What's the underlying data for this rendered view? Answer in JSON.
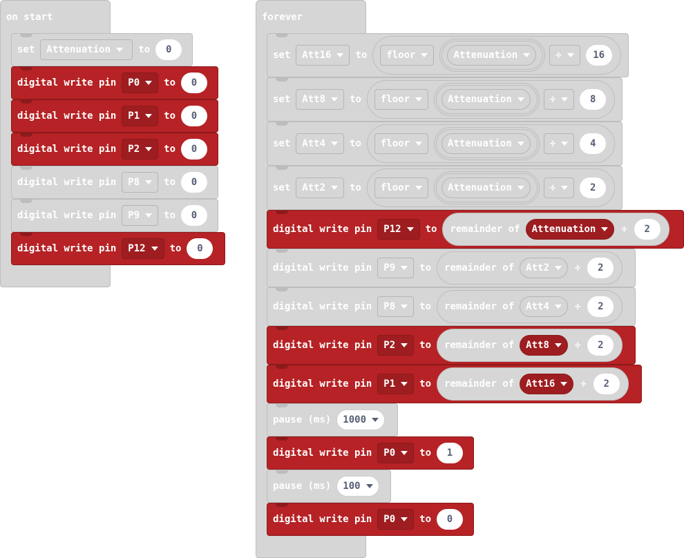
{
  "on_start": {
    "title": "on start",
    "set_block": {
      "set_label": "set",
      "variable": "Attenuation",
      "to_label": "to",
      "value": "0"
    },
    "writes": [
      {
        "label": "digital write pin",
        "pin": "P0",
        "to_label": "to",
        "value": "0",
        "enabled": true
      },
      {
        "label": "digital write pin",
        "pin": "P1",
        "to_label": "to",
        "value": "0",
        "enabled": true
      },
      {
        "label": "digital write pin",
        "pin": "P2",
        "to_label": "to",
        "value": "0",
        "enabled": true
      },
      {
        "label": "digital write pin",
        "pin": "P8",
        "to_label": "to",
        "value": "0",
        "enabled": false
      },
      {
        "label": "digital write pin",
        "pin": "P9",
        "to_label": "to",
        "value": "0",
        "enabled": false
      },
      {
        "label": "digital write pin",
        "pin": "P12",
        "to_label": "to",
        "value": "0",
        "enabled": true
      }
    ]
  },
  "forever": {
    "title": "forever",
    "set_blocks": [
      {
        "set_label": "set",
        "variable": "Att16",
        "to_label": "to",
        "func": "floor",
        "operand": "Attenuation",
        "op": "÷",
        "divisor": "16"
      },
      {
        "set_label": "set",
        "variable": "Att8",
        "to_label": "to",
        "func": "floor",
        "operand": "Attenuation",
        "op": "÷",
        "divisor": "8"
      },
      {
        "set_label": "set",
        "variable": "Att4",
        "to_label": "to",
        "func": "floor",
        "operand": "Attenuation",
        "op": "÷",
        "divisor": "4"
      },
      {
        "set_label": "set",
        "variable": "Att2",
        "to_label": "to",
        "func": "floor",
        "operand": "Attenuation",
        "op": "÷",
        "divisor": "2"
      }
    ],
    "remainder_writes": [
      {
        "label": "digital write pin",
        "pin": "P12",
        "to_label": "to",
        "func": "remainder of",
        "operand": "Attenuation",
        "op": "÷",
        "divisor": "2",
        "enabled": true
      },
      {
        "label": "digital write pin",
        "pin": "P9",
        "to_label": "to",
        "func": "remainder of",
        "operand": "Att2",
        "op": "÷",
        "divisor": "2",
        "enabled": false
      },
      {
        "label": "digital write pin",
        "pin": "P8",
        "to_label": "to",
        "func": "remainder of",
        "operand": "Att4",
        "op": "÷",
        "divisor": "2",
        "enabled": false
      },
      {
        "label": "digital write pin",
        "pin": "P2",
        "to_label": "to",
        "func": "remainder of",
        "operand": "Att8",
        "op": "÷",
        "divisor": "2",
        "enabled": true
      },
      {
        "label": "digital write pin",
        "pin": "P1",
        "to_label": "to",
        "func": "remainder of",
        "operand": "Att16",
        "op": "÷",
        "divisor": "2",
        "enabled": true
      }
    ],
    "pause1": {
      "label": "pause (ms)",
      "value": "1000"
    },
    "write_p0_high": {
      "label": "digital write pin",
      "pin": "P0",
      "to_label": "to",
      "value": "1"
    },
    "pause2": {
      "label": "pause (ms)",
      "value": "100"
    },
    "write_p0_low": {
      "label": "digital write pin",
      "pin": "P0",
      "to_label": "to",
      "value": "0"
    }
  },
  "colors": {
    "pins_block": "#b62225",
    "disabled_block": "#d6d6d6",
    "text_light": "#ffffff",
    "number_text": "#575e75"
  }
}
